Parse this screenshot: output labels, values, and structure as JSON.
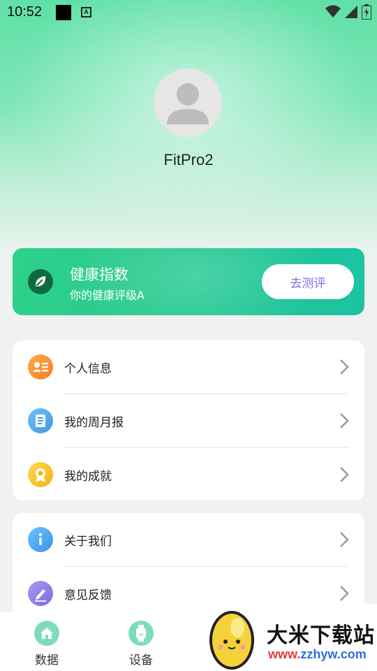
{
  "status_bar": {
    "time": "10:52",
    "notification_badge": "A"
  },
  "profile": {
    "username": "FitPro2",
    "user_id": "ID PL.A"
  },
  "health_card": {
    "title": "健康指数",
    "subtitle": "你的健康评级A",
    "button_label": "去测评"
  },
  "menu_group_1": {
    "items": [
      {
        "label": "个人信息",
        "icon": "id-card-icon",
        "color": "#f7901e"
      },
      {
        "label": "我的周月报",
        "icon": "report-icon",
        "color": "#3fa3e8"
      },
      {
        "label": "我的成就",
        "icon": "medal-icon",
        "color": "#f3c21b"
      }
    ]
  },
  "menu_group_2": {
    "items": [
      {
        "label": "关于我们",
        "icon": "info-icon",
        "color": "#3f9ff0"
      },
      {
        "label": "意见反馈",
        "icon": "feedback-pen-icon",
        "color": "#8a7be8"
      }
    ]
  },
  "bottom_nav": {
    "items": [
      {
        "label": "数据",
        "icon": "home-icon"
      },
      {
        "label": "设备",
        "icon": "watch-icon"
      }
    ]
  },
  "watermark": {
    "title": "大米下载站",
    "url_red": "www.",
    "url_blue": "zzhyw",
    "url_tail": ".com"
  },
  "colors": {
    "accent_green": "#27c98e",
    "button_text": "#7b6fe0"
  }
}
